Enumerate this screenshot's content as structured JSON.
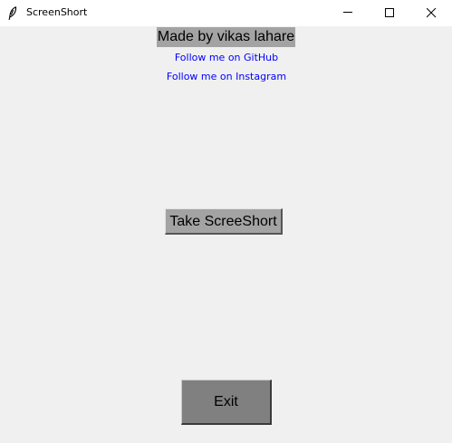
{
  "window": {
    "title": "ScreenShort",
    "app_icon": "feather-icon",
    "controls": {
      "minimize_icon": "minimize-icon",
      "maximize_icon": "maximize-icon",
      "close_icon": "close-icon"
    }
  },
  "content": {
    "credit_label": "Made by vikas lahare",
    "github_link": "Follow me on GitHub",
    "instagram_link": "Follow me on Instagram",
    "screenshot_button": "Take ScreeShort",
    "exit_button": "Exit"
  },
  "colors": {
    "background": "#f0f0f0",
    "label_bg": "#a3a3a3",
    "link": "#0000ff",
    "exit_bg": "#808080"
  }
}
